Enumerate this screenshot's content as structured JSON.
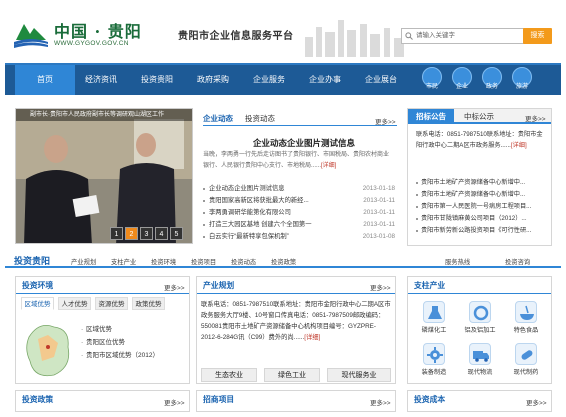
{
  "header": {
    "logo_text": "中国 · 贵阳",
    "logo_url": "WWW.GYGOV.GOV.CN",
    "site_title": "贵阳市企业信息服务平台",
    "search_placeholder": "请输入关键字",
    "search_button": "搜索"
  },
  "nav": {
    "items": [
      "首页",
      "经济资讯",
      "投资贵阳",
      "政府采购",
      "企业服务",
      "企业办事",
      "企业展台"
    ],
    "icon_links": [
      {
        "label": "市民",
        "icon": "citizen-icon"
      },
      {
        "label": "企业",
        "icon": "enterprise-icon"
      },
      {
        "label": "政务",
        "icon": "government-icon"
      },
      {
        "label": "旅游",
        "icon": "plane-icon"
      }
    ]
  },
  "carousel": {
    "caption": "副市长·贵阳市人民政府副市长等调研观山湖区工作",
    "pages": [
      "1",
      "2",
      "3",
      "4",
      "5"
    ],
    "active_page": 1
  },
  "news": {
    "tabs": [
      "企业动态",
      "投资动态"
    ],
    "more": "更多>>",
    "headline": "企业动态企业图片测试信息",
    "summary": "当晚，李两勇一行先后走访图书了贵阳银行、市国税局、贵阳农村商业银行、人民银行贵阳中心支行、市地税局......",
    "summary_link": "[详细]",
    "items": [
      {
        "title": "企业动态企业图片测试信息",
        "date": "2013-01-18"
      },
      {
        "title": "贵阳国家高新区将获批最大的新经...",
        "date": "2013-01-11"
      },
      {
        "title": "李两勇调研华能第化有限公司",
        "date": "2013-01-11"
      },
      {
        "title": "打造三大园区基地 创建六个全国第一",
        "date": "2013-01-11"
      },
      {
        "title": "白云实行“最新特享包保机制”",
        "date": "2013-01-08"
      }
    ]
  },
  "announcements": {
    "tabs": [
      "招标公告",
      "中标公示"
    ],
    "more": "更多>>",
    "contact": "联系电话：0851-7987510联系地址：贵阳市金阳行政中心二期A区市政务服务......",
    "contact_link": "[详细]",
    "items": [
      "贵阳市土地矿产资源储备中心新增中...",
      "贵阳市土地矿产资源储备中心新增中...",
      "贵阳市第一人民医院一号病房工程项目...",
      "贵阳市甘陇镇麻黄公司项目（2012）...",
      "贵阳市新劳新公路投资项目《可行性研..."
    ]
  },
  "invest_bar": {
    "title": "投资贵阳",
    "links": [
      "产业规划",
      "支柱产业",
      "投资环境",
      "投资项目",
      "投资动态",
      "投资政策"
    ],
    "right_links": [
      "服务热线",
      "投资咨询"
    ]
  },
  "invest_env": {
    "title": "投资环境",
    "more": "更多>>",
    "tabs": [
      "区域优势",
      "人才优势",
      "资源优势",
      "政策优势"
    ],
    "items": [
      "区域优势",
      "贵阳区位优势",
      "贵阳市区域优势（2012）"
    ]
  },
  "industry": {
    "title": "产业规划",
    "more": "更多>>",
    "text": "联系电话：0851-7987510联系地址：贵阳市金阳行政中心二期A区市政务服务大厅9楼、10号窗口传真电话：0851-7987509邮政编码：550081贵阳市土地矿产资源储备中心机构项目编号：GYZPRE-2012-6-284G讯（C99）费外的尚......",
    "text_link": "[详细]",
    "buttons": [
      "生态农业",
      "绿色工业",
      "现代服务业"
    ]
  },
  "pillar": {
    "title": "支柱产业",
    "items": [
      {
        "label": "磷煤化工",
        "icon": "chemical-icon"
      },
      {
        "label": "铝及铝加工",
        "icon": "aluminum-icon"
      },
      {
        "label": "特色食品",
        "icon": "food-icon"
      },
      {
        "label": "装备制造",
        "icon": "gear-icon"
      },
      {
        "label": "现代物流",
        "icon": "truck-icon"
      },
      {
        "label": "现代制药",
        "icon": "pill-icon"
      }
    ]
  },
  "bottom": {
    "policy_title": "投资政策",
    "project_title": "招商项目",
    "cost_title": "投资成本",
    "more": "更多>>"
  },
  "colors": {
    "nav_bg": "#1d5a96",
    "accent": "#2f86d6",
    "orange": "#f39a1b",
    "link_red": "#c0392b"
  }
}
